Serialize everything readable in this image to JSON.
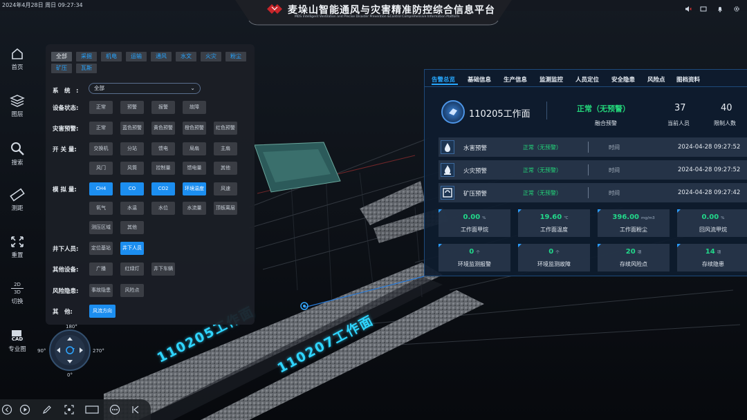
{
  "header": {
    "datetime": "2024年4月28日 周日 09:27:34",
    "title": "麦垛山智能通风与灾害精准防控综合信息平台",
    "subtitle": "MDS Intelligent Ventilation and Precise Disaster Prevention &Control Comprehensive Information Platform",
    "icons": [
      "speaker-icon",
      "window-icon",
      "bell-icon",
      "settings-icon"
    ]
  },
  "nav": {
    "items": [
      {
        "label": "首页",
        "icon": "home-icon"
      },
      {
        "label": "图层",
        "icon": "layers-icon"
      },
      {
        "label": "搜索",
        "icon": "search-icon"
      },
      {
        "label": "测距",
        "icon": "ruler-icon"
      },
      {
        "label": "重置",
        "icon": "expand-icon"
      },
      {
        "label": "切换",
        "icon": "switch-2d3d-icon",
        "top_text": "2D",
        "bottom_text": "3D"
      },
      {
        "label": "专业图",
        "icon": "cad-icon",
        "badge": "CAD"
      }
    ]
  },
  "filter": {
    "categories": [
      "全部",
      "采掘",
      "机电",
      "运输",
      "通风",
      "水文",
      "火灾",
      "粉尘",
      "矿压",
      "瓦斯"
    ],
    "active_category": "全部",
    "system_label": "系　统　:",
    "system_value": "全部",
    "groups": [
      {
        "label": "设备状态:",
        "options": [
          "正常",
          "预警",
          "报警",
          "故障"
        ]
      },
      {
        "label": "灾害预警:",
        "options": [
          "正常",
          "蓝色预警",
          "黄色预警",
          "橙色预警",
          "红色预警"
        ]
      },
      {
        "label": "开 关 量:",
        "options": [
          "交换机",
          "分站",
          "馈电",
          "局扇",
          "主扇",
          "风门",
          "风筒",
          "控制量",
          "馈电量",
          "其他"
        ]
      },
      {
        "label": "模 拟 量:",
        "options": [
          "CH4",
          "CO",
          "CO2",
          "环境温度",
          "风速",
          "氧气",
          "水温",
          "水位",
          "水流量",
          "顶板离层",
          "测压区域",
          "其他"
        ],
        "selected": [
          "CH4",
          "CO",
          "CO2",
          "环境温度"
        ]
      },
      {
        "label": "井下人员:",
        "options": [
          "定位基站",
          "井下人员"
        ],
        "selected": [
          "井下人员"
        ]
      },
      {
        "label": "其他设备:",
        "options": [
          "广播",
          "红绿灯",
          "井下车辆"
        ]
      },
      {
        "label": "风险隐患:",
        "options": [
          "事故隐患",
          "风险点"
        ]
      },
      {
        "label": "其　他:",
        "options": [
          "风流方向"
        ],
        "selected": [
          "风流方向"
        ]
      }
    ]
  },
  "compass": {
    "top": "180°",
    "left": "90°",
    "right": "270°",
    "bottom": "0°"
  },
  "scene": {
    "labels": [
      "110205工作面",
      "110207工作面"
    ]
  },
  "info_panel": {
    "tabs": [
      "告警总览",
      "基础信息",
      "生产信息",
      "监测监控",
      "人员定位",
      "安全隐患",
      "风险点",
      "图档资料"
    ],
    "active_tab": "告警总览",
    "workface": "110205工作面",
    "status": "正常（无预警）",
    "status_label": "融合预警",
    "current_people": "37",
    "current_people_label": "当前人员",
    "limit_people": "40",
    "limit_people_label": "限制人数",
    "alarms": [
      {
        "name": "水害预警",
        "status": "正常（无预警）",
        "time_label": "时间",
        "time": "2024-04-28 09:27:52",
        "icon": "water-drop-icon"
      },
      {
        "name": "火灾预警",
        "status": "正常（无预警）",
        "time_label": "时间",
        "time": "2024-04-28 09:27:52",
        "icon": "fire-icon"
      },
      {
        "name": "矿压预警",
        "status": "正常（无预警）",
        "time_label": "时间",
        "time": "2024-04-28 09:27:42",
        "icon": "pressure-icon"
      }
    ],
    "metrics": [
      {
        "value": "0.00",
        "unit": "%",
        "label": "工作面甲烷"
      },
      {
        "value": "19.60",
        "unit": "℃",
        "label": "工作面温度"
      },
      {
        "value": "396.00",
        "unit": "mg/m3",
        "label": "工作面粉尘"
      },
      {
        "value": "0.00",
        "unit": "%",
        "label": "回风流甲烷"
      },
      {
        "value": "0",
        "unit": "个",
        "label": "环境监测报警"
      },
      {
        "value": "0",
        "unit": "个",
        "label": "环境监测故障"
      },
      {
        "value": "20",
        "unit": "项",
        "label": "存续风险点"
      },
      {
        "value": "14",
        "unit": "项",
        "label": "存续隐患"
      }
    ]
  },
  "toolbar": {
    "icons": [
      "back-icon",
      "play-icon",
      "pen-icon",
      "capture-icon",
      "frame-icon",
      "more-icon",
      "skip-icon"
    ]
  },
  "colors": {
    "accent": "#1c8ef0",
    "ok_green": "#23d67a",
    "scene_label": "#2fd5ff"
  }
}
